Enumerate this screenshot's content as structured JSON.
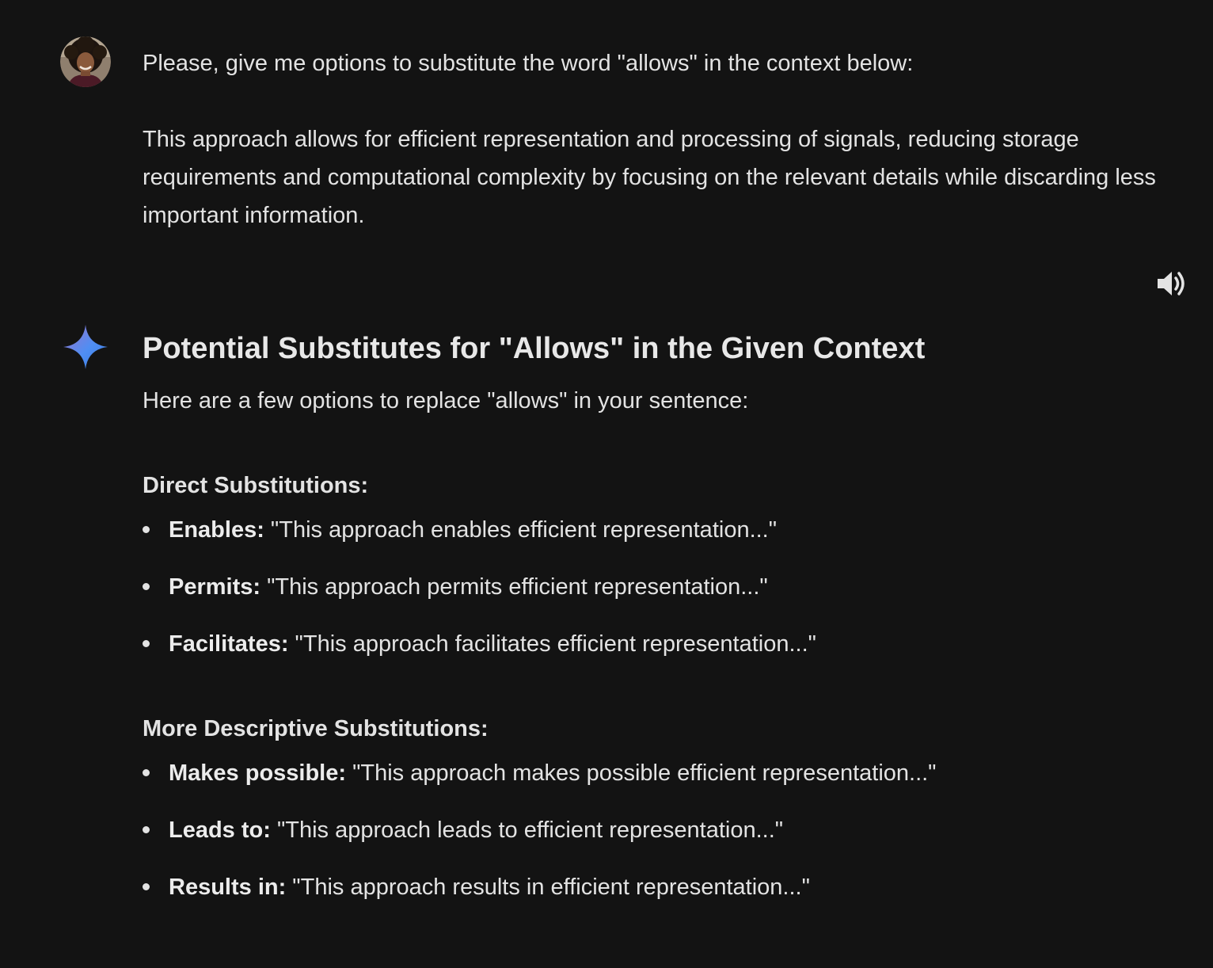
{
  "user_message": {
    "line1": "Please, give me options to substitute the word \"allows\" in the context below:",
    "paragraph": "This approach allows for efficient representation and processing of signals, reducing storage requirements and computational complexity by focusing on the relevant details while discarding less important information."
  },
  "icons": {
    "avatar": "user-avatar",
    "speaker": "speaker-icon",
    "assistant": "gemini-spark-icon"
  },
  "colors": {
    "background": "#131313",
    "text": "#e3e3e3"
  },
  "response": {
    "title": "Potential Substitutes for \"Allows\" in the Given Context",
    "intro": "Here are a few options to replace \"allows\" in your sentence:",
    "sections": [
      {
        "heading": "Direct Substitutions:",
        "items": [
          {
            "term": "Enables:",
            "example": " \"This approach enables efficient representation...\""
          },
          {
            "term": "Permits:",
            "example": " \"This approach permits efficient representation...\""
          },
          {
            "term": "Facilitates:",
            "example": " \"This approach facilitates efficient representation...\""
          }
        ]
      },
      {
        "heading": "More Descriptive Substitutions:",
        "items": [
          {
            "term": "Makes possible:",
            "example": " \"This approach makes possible efficient representation...\""
          },
          {
            "term": "Leads to:",
            "example": " \"This approach leads to efficient representation...\""
          },
          {
            "term": "Results in:",
            "example": " \"This approach results in efficient representation...\""
          }
        ]
      }
    ]
  }
}
